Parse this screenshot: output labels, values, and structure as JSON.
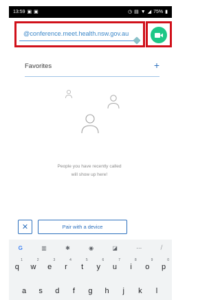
{
  "status_bar": {
    "time": "13:59",
    "battery": "75%"
  },
  "call_input": {
    "value": "@conference.meet.health.nsw.gov.au",
    "accent_color": "#1ec786"
  },
  "favorites": {
    "title": "Favorites",
    "add_symbol": "+"
  },
  "empty_state": {
    "line1": "People you have recently called",
    "line2": "will show up here!"
  },
  "pair": {
    "close_symbol": "✕",
    "label": "Pair with a device"
  },
  "keyboard": {
    "toolbar": [
      "google-icon",
      "clipboard-icon",
      "settings-icon",
      "palette-icon",
      "translate-icon",
      "more-icon",
      "mic-off-icon"
    ],
    "row1": [
      {
        "letter": "q",
        "hint": "1"
      },
      {
        "letter": "w",
        "hint": "2"
      },
      {
        "letter": "e",
        "hint": "3"
      },
      {
        "letter": "r",
        "hint": "4"
      },
      {
        "letter": "t",
        "hint": "5"
      },
      {
        "letter": "y",
        "hint": "6"
      },
      {
        "letter": "u",
        "hint": "7"
      },
      {
        "letter": "i",
        "hint": "8"
      },
      {
        "letter": "o",
        "hint": "9"
      },
      {
        "letter": "p",
        "hint": "0"
      }
    ],
    "row2": [
      "a",
      "s",
      "d",
      "f",
      "g",
      "h",
      "j",
      "k",
      "l"
    ]
  }
}
